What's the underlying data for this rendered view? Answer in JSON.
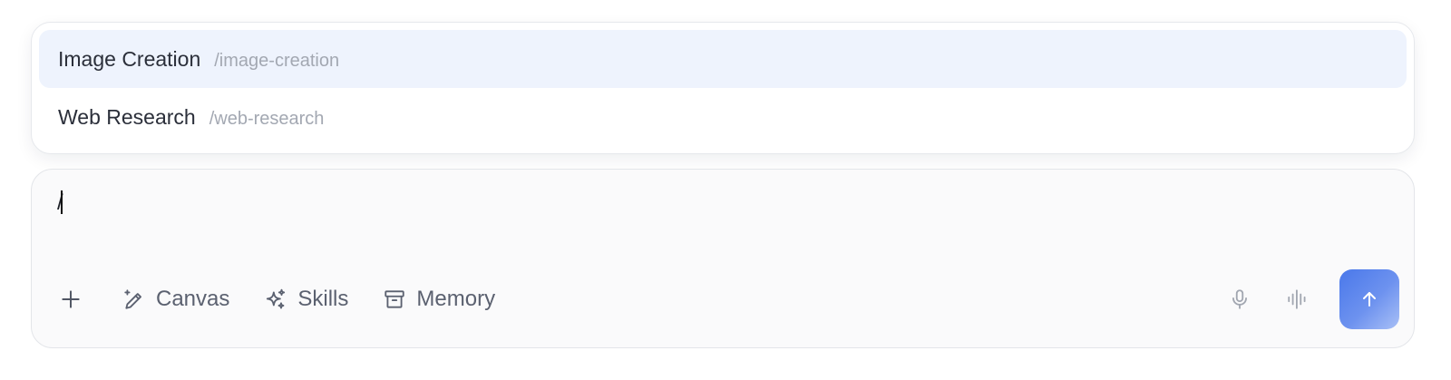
{
  "suggestions": [
    {
      "name": "Image Creation",
      "command": "/image-creation",
      "active": true
    },
    {
      "name": "Web Research",
      "command": "/web-research",
      "active": false
    }
  ],
  "composer": {
    "value": "/"
  },
  "toolbar": {
    "add_icon": "plus-icon",
    "canvas_label": "Canvas",
    "canvas_icon": "pencil-sparkle-icon",
    "skills_label": "Skills",
    "skills_icon": "sparkles-icon",
    "memory_label": "Memory",
    "memory_icon": "archive-box-icon",
    "mic_icon": "microphone-icon",
    "voice_icon": "waveform-icon",
    "send_icon": "arrow-up-icon"
  },
  "colors": {
    "accent": "#4a78ea",
    "active_row": "#eef3fd",
    "muted_text": "#a3a8b2"
  }
}
